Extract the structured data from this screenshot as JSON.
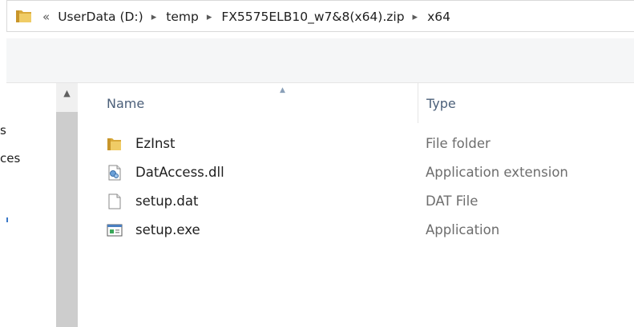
{
  "address_bar": {
    "overflow_glyph": "«",
    "crumbs": [
      "UserData (D:)",
      "temp",
      "FX5575ELB10_w7&8(x64).zip",
      "x64"
    ],
    "separator": "▸"
  },
  "nav_pane": {
    "items": [
      "s",
      "ces"
    ],
    "scroll_up_glyph": "▲"
  },
  "columns": {
    "name": "Name",
    "type": "Type",
    "sort_indicator": "▲"
  },
  "files": [
    {
      "name": "EzInst",
      "type": "File folder",
      "icon": "folder-icon"
    },
    {
      "name": "DatAccess.dll",
      "type": "Application extension",
      "icon": "dll-file-icon"
    },
    {
      "name": "setup.dat",
      "type": "DAT File",
      "icon": "blank-file-icon"
    },
    {
      "name": "setup.exe",
      "type": "Application",
      "icon": "application-exe-icon"
    }
  ],
  "colors": {
    "folder_yellow": "#e8c15a",
    "header_text": "#4c607a",
    "type_text": "#6d6d6d"
  }
}
